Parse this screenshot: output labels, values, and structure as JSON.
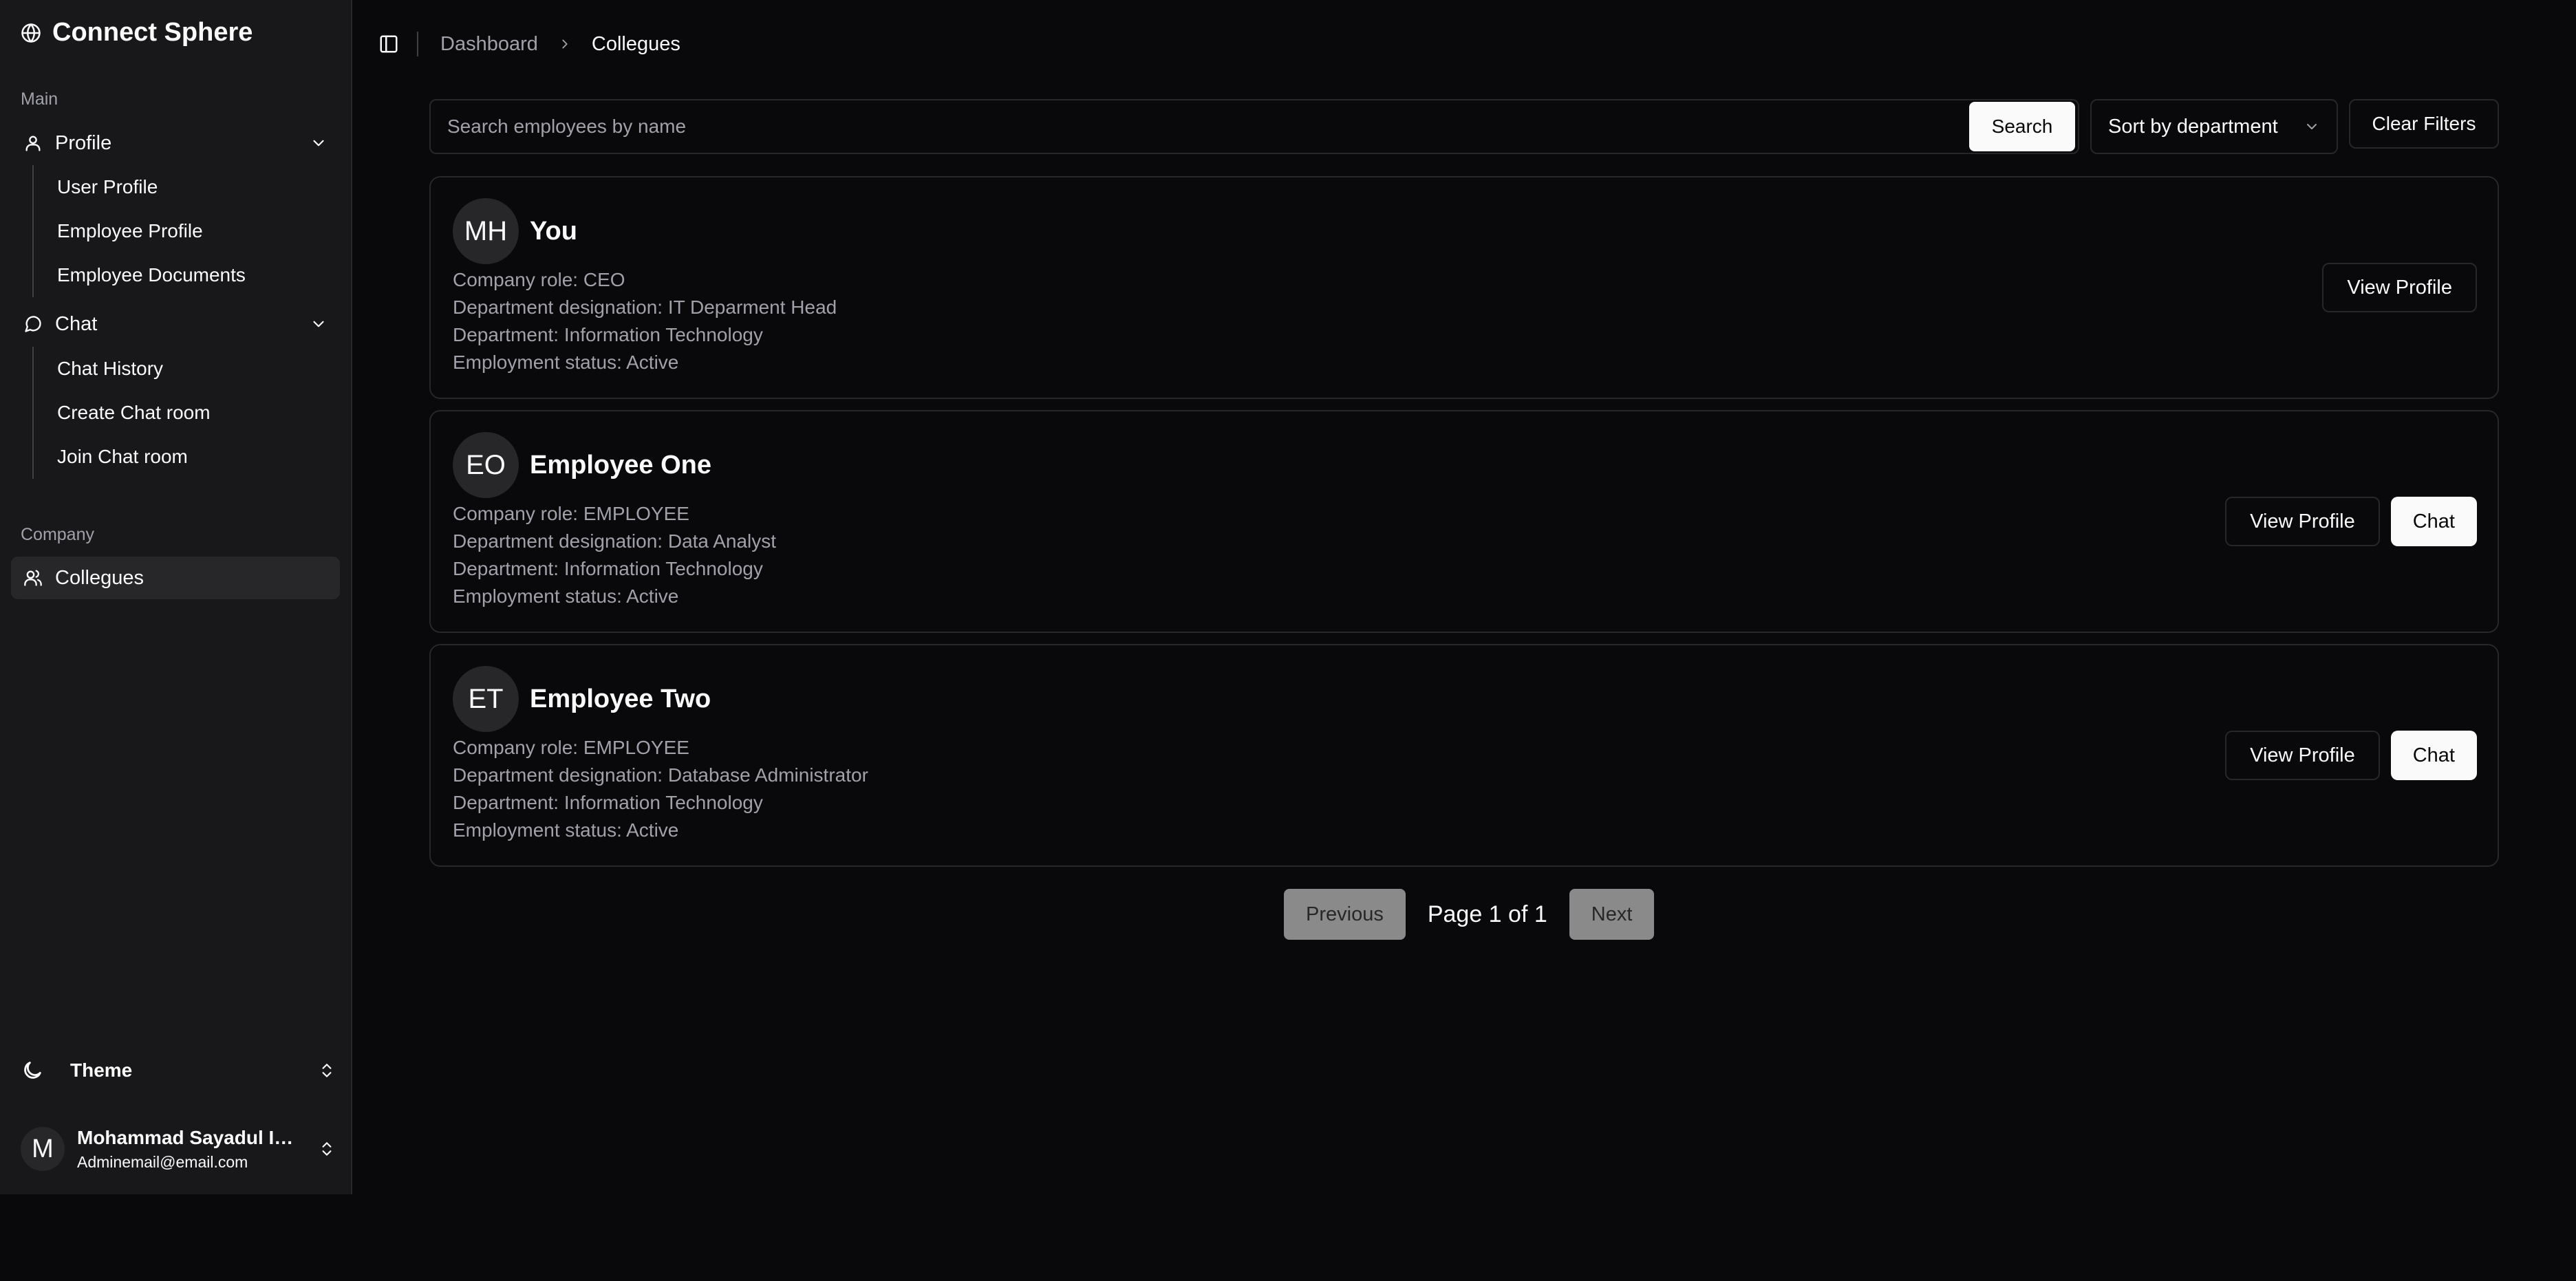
{
  "app": {
    "title": "Connect Sphere",
    "logo_icon": "globe-icon"
  },
  "sidebar": {
    "main_label": "Main",
    "profile": {
      "label": "Profile",
      "items": [
        {
          "label": "User Profile"
        },
        {
          "label": "Employee Profile"
        },
        {
          "label": "Employee Documents"
        }
      ]
    },
    "chat": {
      "label": "Chat",
      "items": [
        {
          "label": "Chat History"
        },
        {
          "label": "Create Chat room"
        },
        {
          "label": "Join Chat room"
        }
      ]
    },
    "company_label": "Company",
    "company_items": [
      {
        "label": "Collegues",
        "active": true
      }
    ],
    "theme_label": "Theme",
    "user": {
      "initial": "M",
      "name": "Mohammad Sayadul Islam",
      "email": "Adminemail@email.com"
    }
  },
  "header": {
    "breadcrumb": [
      "Dashboard",
      "Collegues"
    ]
  },
  "filters": {
    "search_placeholder": "Search employees by name",
    "search_value": "",
    "search_button": "Search",
    "sort_label": "Sort by department",
    "clear_button": "Clear Filters"
  },
  "employees": [
    {
      "initials": "MH",
      "name": "You",
      "role": "Company role: CEO",
      "designation": "Department designation: IT Deparment Head",
      "department": "Department: Information Technology",
      "status": "Employment status: Active",
      "view_label": "View Profile"
    },
    {
      "initials": "EO",
      "name": "Employee One",
      "role": "Company role: EMPLOYEE",
      "designation": "Department designation: Data Analyst",
      "department": "Department: Information Technology",
      "status": "Employment status: Active",
      "view_label": "View Profile",
      "chat_label": "Chat"
    },
    {
      "initials": "ET",
      "name": "Employee Two",
      "role": "Company role: EMPLOYEE",
      "designation": "Department designation: Database Administrator",
      "department": "Department: Information Technology",
      "status": "Employment status: Active",
      "view_label": "View Profile",
      "chat_label": "Chat"
    }
  ],
  "pagination": {
    "previous": "Previous",
    "info": "Page 1 of 1",
    "next": "Next"
  },
  "colors": {
    "background": "#09090b",
    "sidebar": "#18181b",
    "border": "#27272a",
    "text": "#fafafa",
    "muted": "#a1a1aa"
  }
}
